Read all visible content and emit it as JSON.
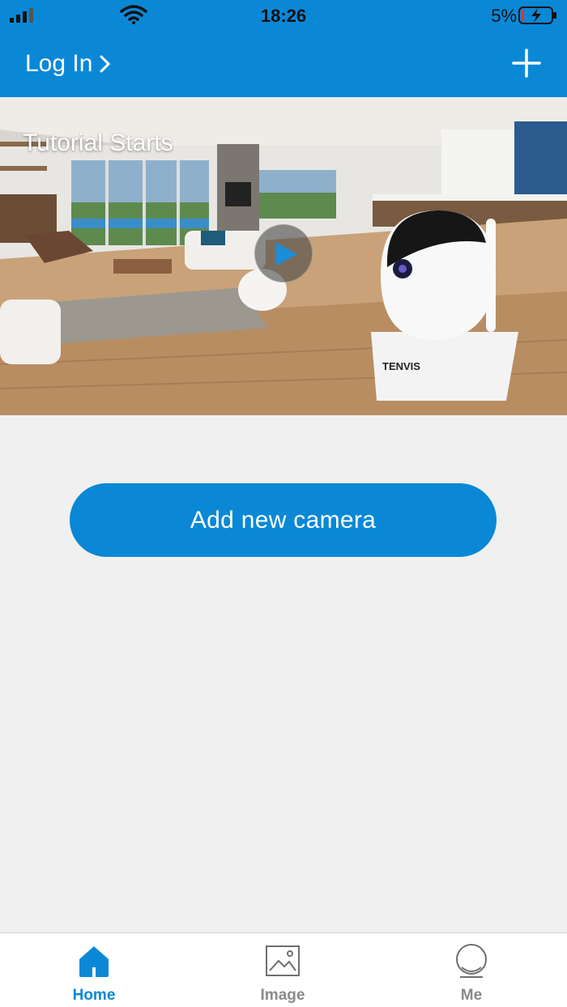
{
  "status_bar": {
    "time": "18:26",
    "battery_percent": "5%",
    "signal_icon": "cellular-signal-icon",
    "wifi_icon": "wifi-icon",
    "battery_icon": "battery-charging-icon"
  },
  "header": {
    "login_label": "Log In",
    "login_chevron_icon": "chevron-right-icon",
    "add_icon": "plus-icon"
  },
  "hero": {
    "title": "Tutorial Starts",
    "play_icon": "play-icon",
    "camera_brand": "TENVIS"
  },
  "main": {
    "add_camera_label": "Add new camera"
  },
  "tabs": [
    {
      "label": "Home",
      "icon": "home-icon",
      "active": true
    },
    {
      "label": "Image",
      "icon": "image-icon",
      "active": false
    },
    {
      "label": "Me",
      "icon": "user-icon",
      "active": false
    }
  ],
  "colors": {
    "accent": "#0a88d6",
    "background": "#f0f0f0",
    "tab_inactive": "#8a8a8a"
  }
}
